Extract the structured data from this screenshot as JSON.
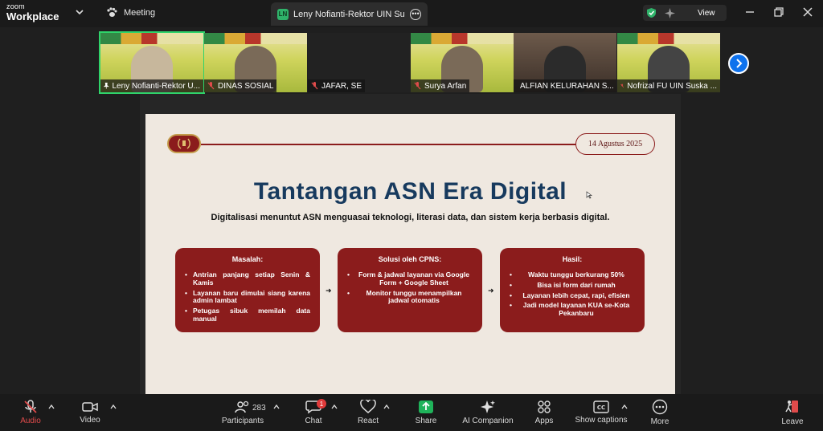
{
  "app": {
    "logo_line1": "zoom",
    "logo_line2": "Workplace",
    "meeting_label": "Meeting"
  },
  "tab": {
    "badge": "LN",
    "title": "Leny Nofianti-Rektor UIN Suska R"
  },
  "security": {
    "view_label": "View"
  },
  "participants_strip": [
    {
      "name": "Leny Nofianti-Rektor U...",
      "muted": false,
      "active": true
    },
    {
      "name": "DINAS SOSIAL",
      "muted": true,
      "active": false
    },
    {
      "name": "JAFAR, SE",
      "muted": true,
      "active": false
    },
    {
      "name": "Surya Arfan",
      "muted": true,
      "active": false
    },
    {
      "name": "ALFIAN KELURAHAN S...",
      "muted": true,
      "active": false
    },
    {
      "name": "Nofrizal FU UIN Suska ...",
      "muted": true,
      "active": false
    }
  ],
  "slide": {
    "date": "14 Agustus 2025",
    "title": "Tantangan ASN Era Digital",
    "subtitle": "Digitalisasi menuntut ASN menguasai teknologi, literasi data, dan sistem kerja berbasis digital.",
    "boxes": [
      {
        "heading": "Masalah:",
        "items": [
          "Antrian panjang setiap Senin & Kamis",
          "Layanan baru dimulai siang karena admin lambat",
          "Petugas sibuk memilah data manual"
        ]
      },
      {
        "heading": "Solusi oleh CPNS:",
        "items": [
          "Form & jadwal layanan via Google Form + Google Sheet",
          "Monitor tunggu menampilkan jadwal otomatis"
        ]
      },
      {
        "heading": "Hasil:",
        "items": [
          "Waktu tunggu berkurang 50%",
          "Bisa isi form dari rumah",
          "Layanan lebih cepat, rapi, efisien",
          "Jadi model layanan KUA se-Kota Pekanbaru"
        ]
      }
    ],
    "arrow": "➜"
  },
  "toolbar": {
    "audio": "Audio",
    "video": "Video",
    "participants": "Participants",
    "participants_count": "283",
    "chat": "Chat",
    "chat_badge": "1",
    "react": "React",
    "share": "Share",
    "ai_companion": "AI Companion",
    "apps": "Apps",
    "show_captions": "Show captions",
    "more": "More",
    "leave": "Leave"
  },
  "colors": {
    "accent_green": "#2fd36a",
    "zoom_blue": "#0e72ed",
    "slide_maroon": "#8b1c1c",
    "title_navy": "#173a5e",
    "share_green": "#1fb35a"
  }
}
